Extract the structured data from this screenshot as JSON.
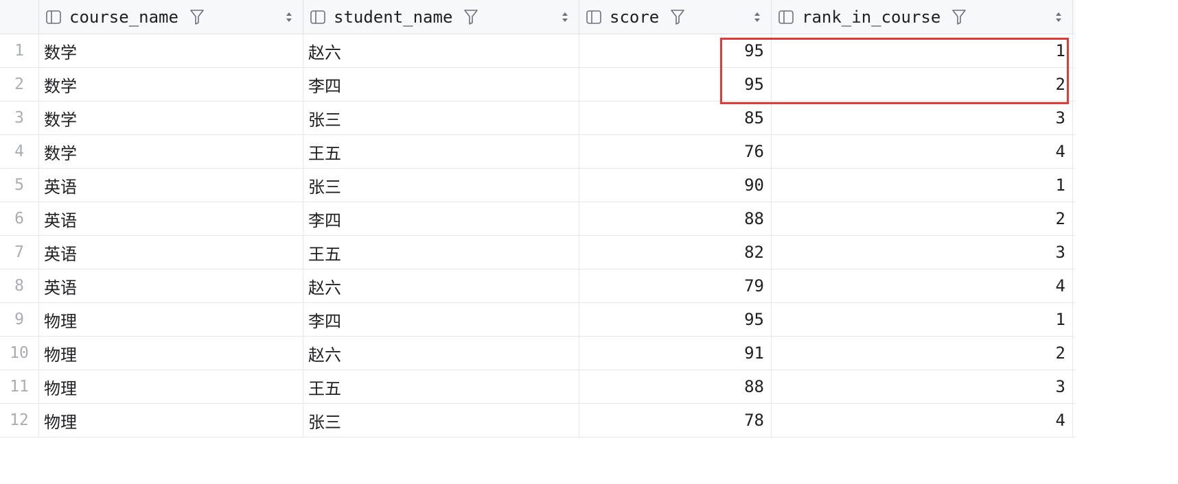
{
  "columns": [
    {
      "label": "course_name",
      "icon": "column-icon",
      "filter": "filter-icon",
      "sort": "sort-icon"
    },
    {
      "label": "student_name",
      "icon": "column-icon",
      "filter": "filter-icon",
      "sort": "sort-icon"
    },
    {
      "label": "score",
      "icon": "column-icon",
      "filter": "filter-icon",
      "sort": "sort-icon"
    },
    {
      "label": "rank_in_course",
      "icon": "column-icon",
      "filter": "filter-icon",
      "sort": "sort-icon"
    }
  ],
  "rows": [
    {
      "n": "1",
      "course": "数学",
      "student": "赵六",
      "score": "95",
      "rank": "1"
    },
    {
      "n": "2",
      "course": "数学",
      "student": "李四",
      "score": "95",
      "rank": "2"
    },
    {
      "n": "3",
      "course": "数学",
      "student": "张三",
      "score": "85",
      "rank": "3"
    },
    {
      "n": "4",
      "course": "数学",
      "student": "王五",
      "score": "76",
      "rank": "4"
    },
    {
      "n": "5",
      "course": "英语",
      "student": "张三",
      "score": "90",
      "rank": "1"
    },
    {
      "n": "6",
      "course": "英语",
      "student": "李四",
      "score": "88",
      "rank": "2"
    },
    {
      "n": "7",
      "course": "英语",
      "student": "王五",
      "score": "82",
      "rank": "3"
    },
    {
      "n": "8",
      "course": "英语",
      "student": "赵六",
      "score": "79",
      "rank": "4"
    },
    {
      "n": "9",
      "course": "物理",
      "student": "李四",
      "score": "95",
      "rank": "1"
    },
    {
      "n": "10",
      "course": "物理",
      "student": "赵六",
      "score": "91",
      "rank": "2"
    },
    {
      "n": "11",
      "course": "物理",
      "student": "王五",
      "score": "88",
      "rank": "3"
    },
    {
      "n": "12",
      "course": "物理",
      "student": "张三",
      "score": "78",
      "rank": "4"
    }
  ],
  "colors": {
    "highlight": "#e53935",
    "header_bg": "#f7f8fa",
    "row_number": "#a8adb6"
  }
}
